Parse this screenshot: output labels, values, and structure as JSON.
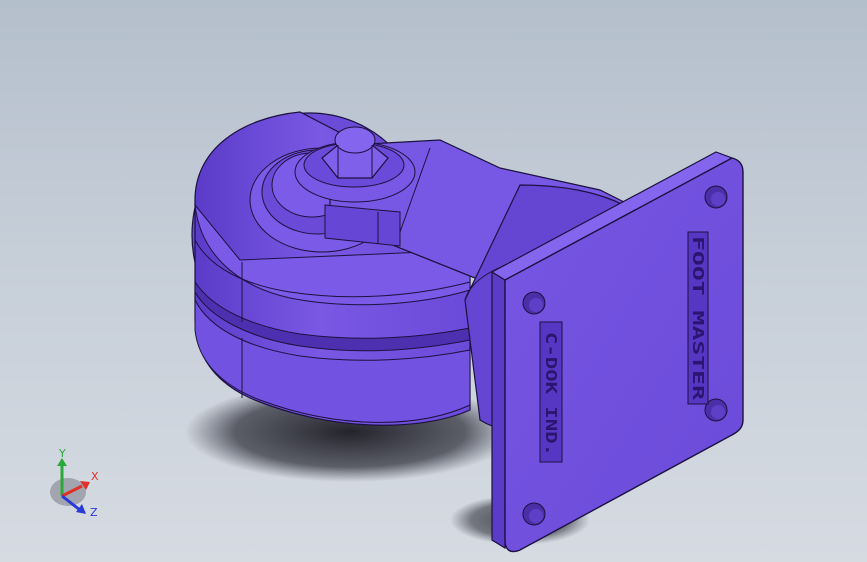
{
  "viewport": {
    "background_top": "#b4bfcc",
    "background_bottom": "#d6dbe2"
  },
  "model": {
    "part_color": "#7755e0",
    "edge_color": "#1c1240",
    "mounting_plate": {
      "brand_text_1": "FOOT MASTER",
      "brand_text_2": "C-DOK IND."
    }
  },
  "triad": {
    "x_label": "X",
    "y_label": "Y",
    "z_label": "Z",
    "x_color": "#e0302a",
    "y_color": "#2aa83a",
    "z_color": "#2a3ad8"
  }
}
